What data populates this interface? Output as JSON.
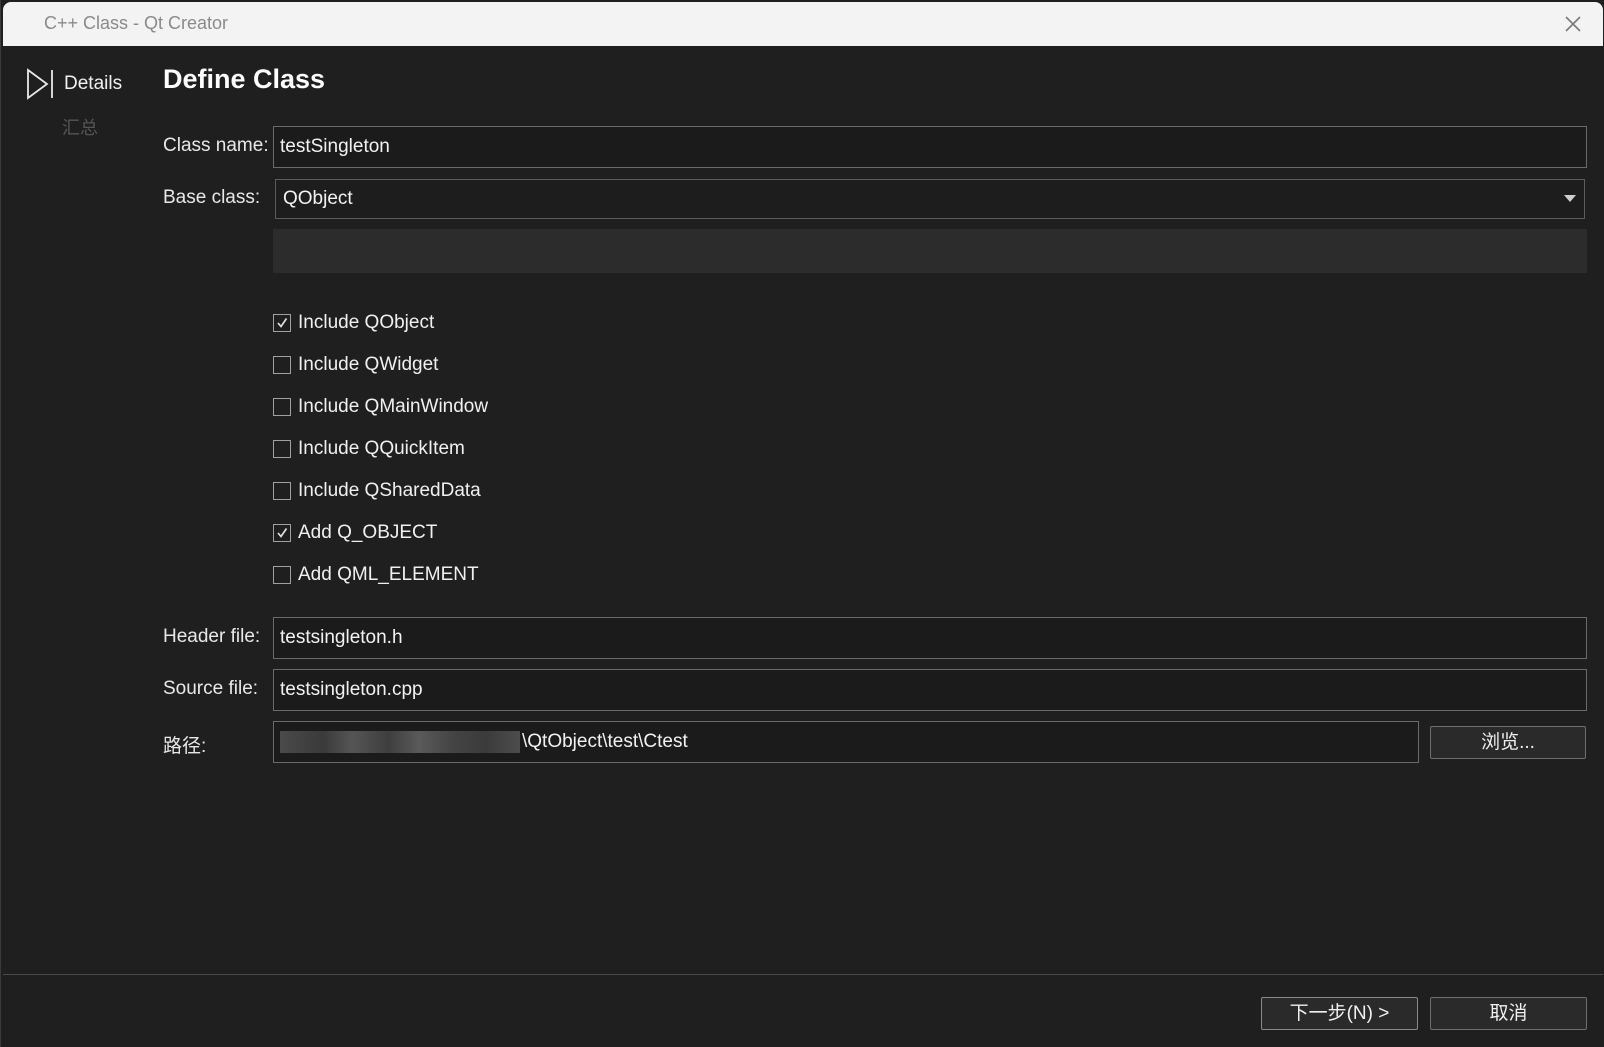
{
  "window": {
    "title": "C++ Class - Qt Creator"
  },
  "sidebar": {
    "steps": [
      {
        "label": "Details",
        "active": true
      },
      {
        "label": "汇总",
        "active": false
      }
    ]
  },
  "page": {
    "title": "Define Class"
  },
  "form": {
    "class_name_label": "Class name:",
    "class_name_value": "testSingleton",
    "base_class_label": "Base class:",
    "base_class_value": "QObject",
    "checkboxes": [
      {
        "label": "Include QObject",
        "checked": true
      },
      {
        "label": "Include QWidget",
        "checked": false
      },
      {
        "label": "Include QMainWindow",
        "checked": false
      },
      {
        "label": "Include QQuickItem",
        "checked": false
      },
      {
        "label": "Include QSharedData",
        "checked": false
      },
      {
        "label": "Add Q_OBJECT",
        "checked": true
      },
      {
        "label": "Add QML_ELEMENT",
        "checked": false
      }
    ],
    "header_file_label": "Header file:",
    "header_file_value": "testsingleton.h",
    "source_file_label": "Source file:",
    "source_file_value": "testsingleton.cpp",
    "path_label": "路径:",
    "path_visible_suffix": "\\QtObject\\test\\Ctest",
    "browse_label": "浏览..."
  },
  "footer": {
    "next_label": "下一步(N) >",
    "cancel_label": "取消"
  },
  "icons": {
    "close": "close-icon",
    "step_arrow": "play-arrow-icon",
    "dropdown": "chevron-down-icon",
    "checkmark": "checkmark-icon"
  }
}
